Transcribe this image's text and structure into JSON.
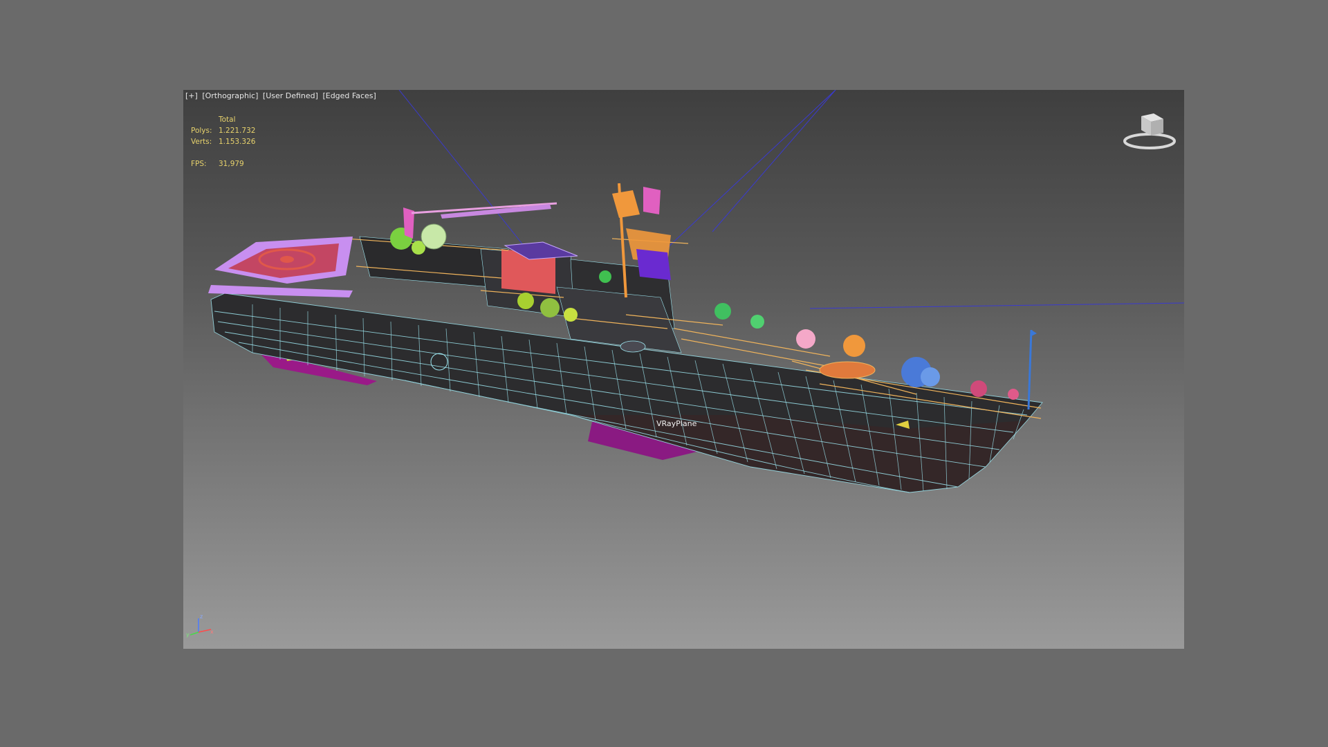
{
  "viewport": {
    "label_items": [
      "[+]",
      "[Orthographic]",
      "[User Defined]",
      "[Edged Faces]"
    ]
  },
  "stats": {
    "header": "Total",
    "polys_label": "Polys:",
    "polys_value": "1.221.732",
    "verts_label": "Verts:",
    "verts_value": "1.153.326",
    "fps_label": "FPS:",
    "fps_value": "31,979"
  },
  "scene": {
    "object_label": "VRayPlane"
  },
  "icons": {
    "viewcube": "viewcube-icon",
    "axis": "axis-tripod-icon"
  },
  "colors": {
    "background": "#6a6a6a",
    "viewport_top": "#3f3f3f",
    "viewport_bottom": "#9a9a9a",
    "stats_text": "#e7d26c",
    "hull": "#2c2c2e",
    "wireframe": "#9ee8f2",
    "railings": "#f0b45c",
    "helipad": "#c88ff0",
    "helipad_mark": "#e0584a",
    "vray_plane": "#8a1a82",
    "light_lines": "#3a3ad0"
  }
}
